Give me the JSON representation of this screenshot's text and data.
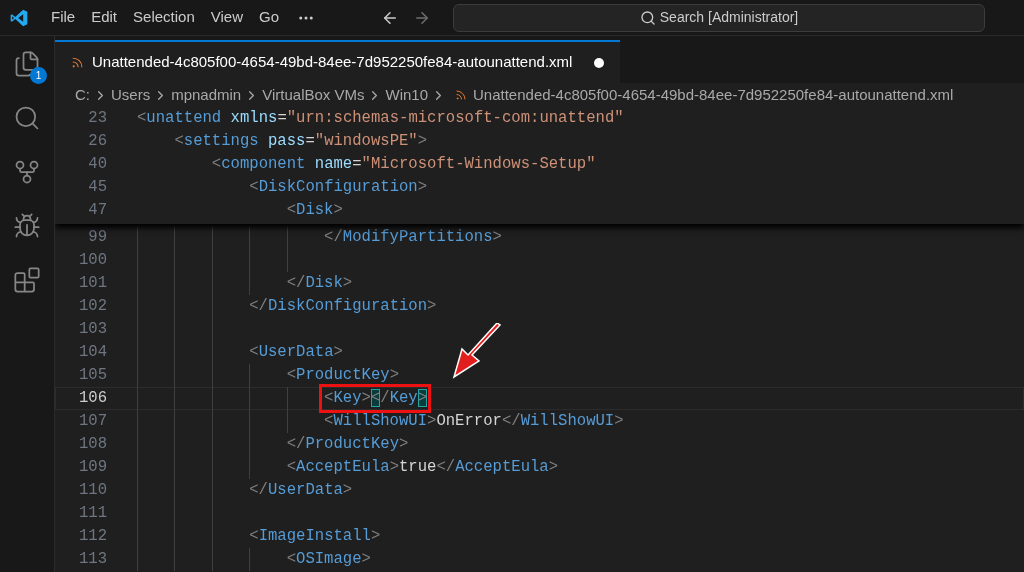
{
  "menu": [
    "File",
    "Edit",
    "Selection",
    "View",
    "Go"
  ],
  "search": {
    "placeholder": "Search [Administrator]"
  },
  "activity_bar": [
    {
      "kind": "files",
      "badge": "1"
    },
    {
      "kind": "search"
    },
    {
      "kind": "source-control"
    },
    {
      "kind": "debug"
    },
    {
      "kind": "extensions"
    }
  ],
  "tab": {
    "label": "Unattended-4c805f00-4654-49bd-84ee-7d952250fe84-autounattend.xml",
    "dirty": true
  },
  "breadcrumb": [
    "C:",
    "Users",
    "mpnadmin",
    "VirtualBox VMs",
    "Win10",
    "Unattended-4c805f00-4654-49bd-84ee-7d952250fe84-autounattend.xml"
  ],
  "sticky_lines": [
    {
      "number": "23",
      "tokens": [
        {
          "kind": "p",
          "text": "<"
        },
        {
          "kind": "tag",
          "text": "unattend"
        },
        {
          "kind": "attr",
          "text": "xmlns"
        },
        {
          "kind": "text",
          "text": "="
        },
        {
          "kind": "str",
          "text": "\"urn:schemas-microsoft-com:unattend\""
        }
      ],
      "children": [
        {
          "number": "26",
          "tokens": [
            {
              "kind": "p",
              "text": "<"
            },
            {
              "kind": "tag",
              "text": "settings"
            },
            {
              "kind": "attr",
              "text": "pass"
            },
            {
              "kind": "text",
              "text": "="
            },
            {
              "kind": "str",
              "text": "\"windowsPE\""
            },
            {
              "kind": "p",
              "text": ">"
            }
          ],
          "children": [
            {
              "number": "40",
              "tokens": [
                {
                  "kind": "p",
                  "text": "<"
                },
                {
                  "kind": "tag",
                  "text": "component"
                },
                {
                  "kind": "attr",
                  "text": "name"
                },
                {
                  "kind": "text",
                  "text": "="
                },
                {
                  "kind": "str",
                  "text": "\"Microsoft-Windows-Setup\""
                }
              ],
              "children": [
                {
                  "number": "45",
                  "tokens": [
                    {
                      "kind": "p",
                      "text": "<"
                    },
                    {
                      "kind": "tag",
                      "text": "DiskConfiguration"
                    },
                    {
                      "kind": "p",
                      "text": ">"
                    }
                  ],
                  "children": [
                    {
                      "number": "47",
                      "tokens": [
                        {
                          "kind": "p",
                          "text": "<"
                        },
                        {
                          "kind": "tag",
                          "text": "Disk"
                        },
                        {
                          "kind": "p",
                          "text": ">"
                        }
                      ]
                    }
                  ]
                }
              ]
            }
          ]
        }
      ]
    }
  ],
  "lines": [
    {
      "children": [
        {
          "children": [
            {
              "children": [
                {
                  "children": [
                    {
                      "children": [
                        {
                          "number": "99",
                          "current": false,
                          "tokens": [
                            {
                              "kind": "p",
                              "text": "</"
                            },
                            {
                              "kind": "tag",
                              "text": "ModifyPartitions"
                            },
                            {
                              "kind": "p",
                              "text": ">"
                            }
                          ]
                        },
                        {
                          "number": "100",
                          "current": false
                        }
                      ]
                    },
                    {
                      "number": "101",
                      "current": false,
                      "tokens": [
                        {
                          "kind": "p",
                          "text": "</"
                        },
                        {
                          "kind": "tag",
                          "text": "Disk"
                        },
                        {
                          "kind": "p",
                          "text": ">"
                        }
                      ]
                    }
                  ]
                },
                {
                  "number": "102",
                  "current": false,
                  "tokens": [
                    {
                      "kind": "p",
                      "text": "</"
                    },
                    {
                      "kind": "tag",
                      "text": "DiskConfiguration"
                    },
                    {
                      "kind": "p",
                      "text": ">"
                    }
                  ]
                },
                {
                  "number": "103",
                  "current": false
                },
                {
                  "number": "104",
                  "current": false,
                  "tokens": [
                    {
                      "kind": "p",
                      "text": "<"
                    },
                    {
                      "kind": "tag",
                      "text": "UserData"
                    },
                    {
                      "kind": "p",
                      "text": ">"
                    }
                  ],
                  "children": [
                    {
                      "number": "105",
                      "current": false,
                      "tokens": [
                        {
                          "kind": "p",
                          "text": "<"
                        },
                        {
                          "kind": "tag",
                          "text": "ProductKey"
                        },
                        {
                          "kind": "p",
                          "text": ">"
                        }
                      ],
                      "children": [
                        {
                          "number": "106",
                          "current": true,
                          "annotation": {
                            "kind": "box-arrow"
                          },
                          "tokens": [
                            {
                              "kind": "p",
                              "text": "<"
                            },
                            {
                              "kind": "tag",
                              "text": "Key"
                            },
                            {
                              "kind": "p",
                              "text": ">"
                            },
                            {
                              "kind": "match",
                              "text": "<"
                            },
                            {
                              "kind": "p",
                              "text": "/"
                            },
                            {
                              "kind": "tag",
                              "text": "Key"
                            },
                            {
                              "kind": "match",
                              "text": ">"
                            }
                          ]
                        },
                        {
                          "number": "107",
                          "current": false,
                          "tokens": [
                            {
                              "kind": "p",
                              "text": "<"
                            },
                            {
                              "kind": "tag",
                              "text": "WillShowUI"
                            },
                            {
                              "kind": "p",
                              "text": ">"
                            },
                            {
                              "kind": "text",
                              "text": "OnError"
                            },
                            {
                              "kind": "p",
                              "text": "</"
                            },
                            {
                              "kind": "tag",
                              "text": "WillShowUI"
                            },
                            {
                              "kind": "p",
                              "text": ">"
                            }
                          ]
                        }
                      ]
                    },
                    {
                      "number": "108",
                      "current": false,
                      "tokens": [
                        {
                          "kind": "p",
                          "text": "</"
                        },
                        {
                          "kind": "tag",
                          "text": "ProductKey"
                        },
                        {
                          "kind": "p",
                          "text": ">"
                        }
                      ]
                    },
                    {
                      "number": "109",
                      "current": false,
                      "tokens": [
                        {
                          "kind": "p",
                          "text": "<"
                        },
                        {
                          "kind": "tag",
                          "text": "AcceptEula"
                        },
                        {
                          "kind": "p",
                          "text": ">"
                        },
                        {
                          "kind": "text",
                          "text": "true"
                        },
                        {
                          "kind": "p",
                          "text": "</"
                        },
                        {
                          "kind": "tag",
                          "text": "AcceptEula"
                        },
                        {
                          "kind": "p",
                          "text": ">"
                        }
                      ]
                    }
                  ]
                },
                {
                  "number": "110",
                  "current": false,
                  "tokens": [
                    {
                      "kind": "p",
                      "text": "</"
                    },
                    {
                      "kind": "tag",
                      "text": "UserData"
                    },
                    {
                      "kind": "p",
                      "text": ">"
                    }
                  ]
                },
                {
                  "number": "111",
                  "current": false
                },
                {
                  "number": "112",
                  "current": false,
                  "tokens": [
                    {
                      "kind": "p",
                      "text": "<"
                    },
                    {
                      "kind": "tag",
                      "text": "ImageInstall"
                    },
                    {
                      "kind": "p",
                      "text": ">"
                    }
                  ],
                  "children": [
                    {
                      "number": "113",
                      "current": false,
                      "tokens": [
                        {
                          "kind": "p",
                          "text": "<"
                        },
                        {
                          "kind": "tag",
                          "text": "OSImage"
                        },
                        {
                          "kind": "p",
                          "text": ">"
                        }
                      ]
                    }
                  ]
                }
              ]
            }
          ]
        }
      ]
    }
  ]
}
